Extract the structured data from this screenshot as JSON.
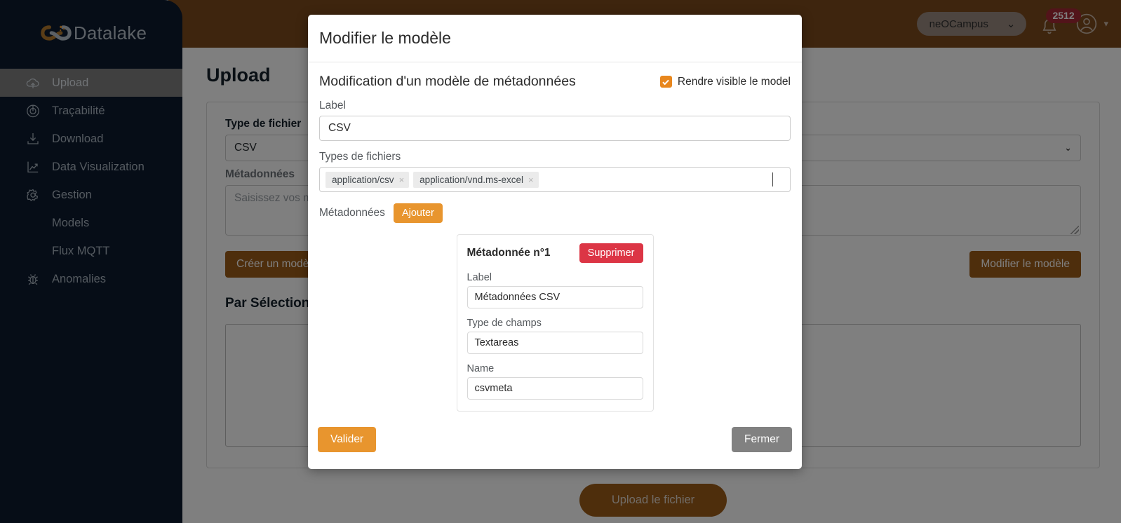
{
  "sidebar": {
    "logo_text": "Datalake",
    "items": [
      {
        "label": "Upload",
        "icon": "cloud-upload-icon",
        "active": true
      },
      {
        "label": "Traçabilité",
        "icon": "radar-icon",
        "active": false
      },
      {
        "label": "Download",
        "icon": "download-icon",
        "active": false
      },
      {
        "label": "Data Visualization",
        "icon": "chart-line-icon",
        "active": false
      },
      {
        "label": "Gestion",
        "icon": "gear-icon",
        "active": false
      },
      {
        "label": "Models",
        "icon": "",
        "active": false
      },
      {
        "label": "Flux MQTT",
        "icon": "",
        "active": false
      },
      {
        "label": "Anomalies",
        "icon": "bug-icon",
        "active": false
      }
    ]
  },
  "topbar": {
    "org_name": "neOCampus",
    "org_caret": "⌄",
    "notification_count": "2512",
    "bell_icon": "bell-icon",
    "avatar_icon": "user-circle-icon",
    "avatar_caret": "▾"
  },
  "page": {
    "title": "Upload",
    "type_label": "Type de fichier",
    "type_value": "CSV",
    "metadata_label": "Métadonnées",
    "metadata_placeholder": "Saisissez vos métadonnées",
    "create_button": "Créer un modèle",
    "modify_button": "Modifier le modèle",
    "section_title": "Par Sélection",
    "upload_button": "Upload le fichier",
    "select_caret": "⌄"
  },
  "modal": {
    "title": "Modifier le modèle",
    "subtitle": "Modification d'un modèle de métadonnées",
    "visible_checkbox_label": "Rendre visible le model",
    "visible_checked": true,
    "label_field_label": "Label",
    "label_field_value": "CSV",
    "filetypes_label": "Types de fichiers",
    "filetypes": [
      {
        "text": "application/csv",
        "remove": "×"
      },
      {
        "text": "application/vnd.ms-excel",
        "remove": "×"
      }
    ],
    "metadata_label": "Métadonnées",
    "add_button": "Ajouter",
    "metadata_cards": [
      {
        "title": "Métadonnée n°1",
        "delete_button": "Supprimer",
        "fields": [
          {
            "label": "Label",
            "value": "Métadonnées CSV"
          },
          {
            "label": "Type de champs",
            "value": "Textareas"
          },
          {
            "label": "Name",
            "value": "csvmeta"
          }
        ]
      }
    ],
    "validate_button": "Valider",
    "close_button": "Fermer"
  },
  "colors": {
    "sidebar_bg": "#0d1b2e",
    "topbar_bg": "#7c4a1d",
    "accent_orange": "#e8952e",
    "danger_red": "#dc3545",
    "brown_button": "#9c5c18",
    "grey_button": "#818181",
    "badge_red": "#a52834"
  }
}
